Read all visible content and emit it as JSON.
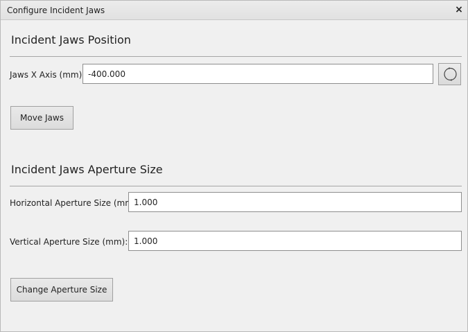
{
  "window": {
    "title": "Configure Incident Jaws",
    "close_glyph": "×"
  },
  "position_section": {
    "title": "Incident Jaws Position",
    "jaws_x_label": "Jaws X Axis (mm):",
    "jaws_x_value": "-400.000",
    "refresh_icon": "refresh-icon",
    "move_button_label": "Move Jaws"
  },
  "aperture_section": {
    "title": "Incident Jaws Aperture Size",
    "horizontal_label": "Horizontal Aperture Size (mm):",
    "horizontal_value": "1.000",
    "vertical_label": "Vertical Aperture Size (mm):",
    "vertical_value": "1.000",
    "change_button_label": "Change Aperture Size"
  }
}
